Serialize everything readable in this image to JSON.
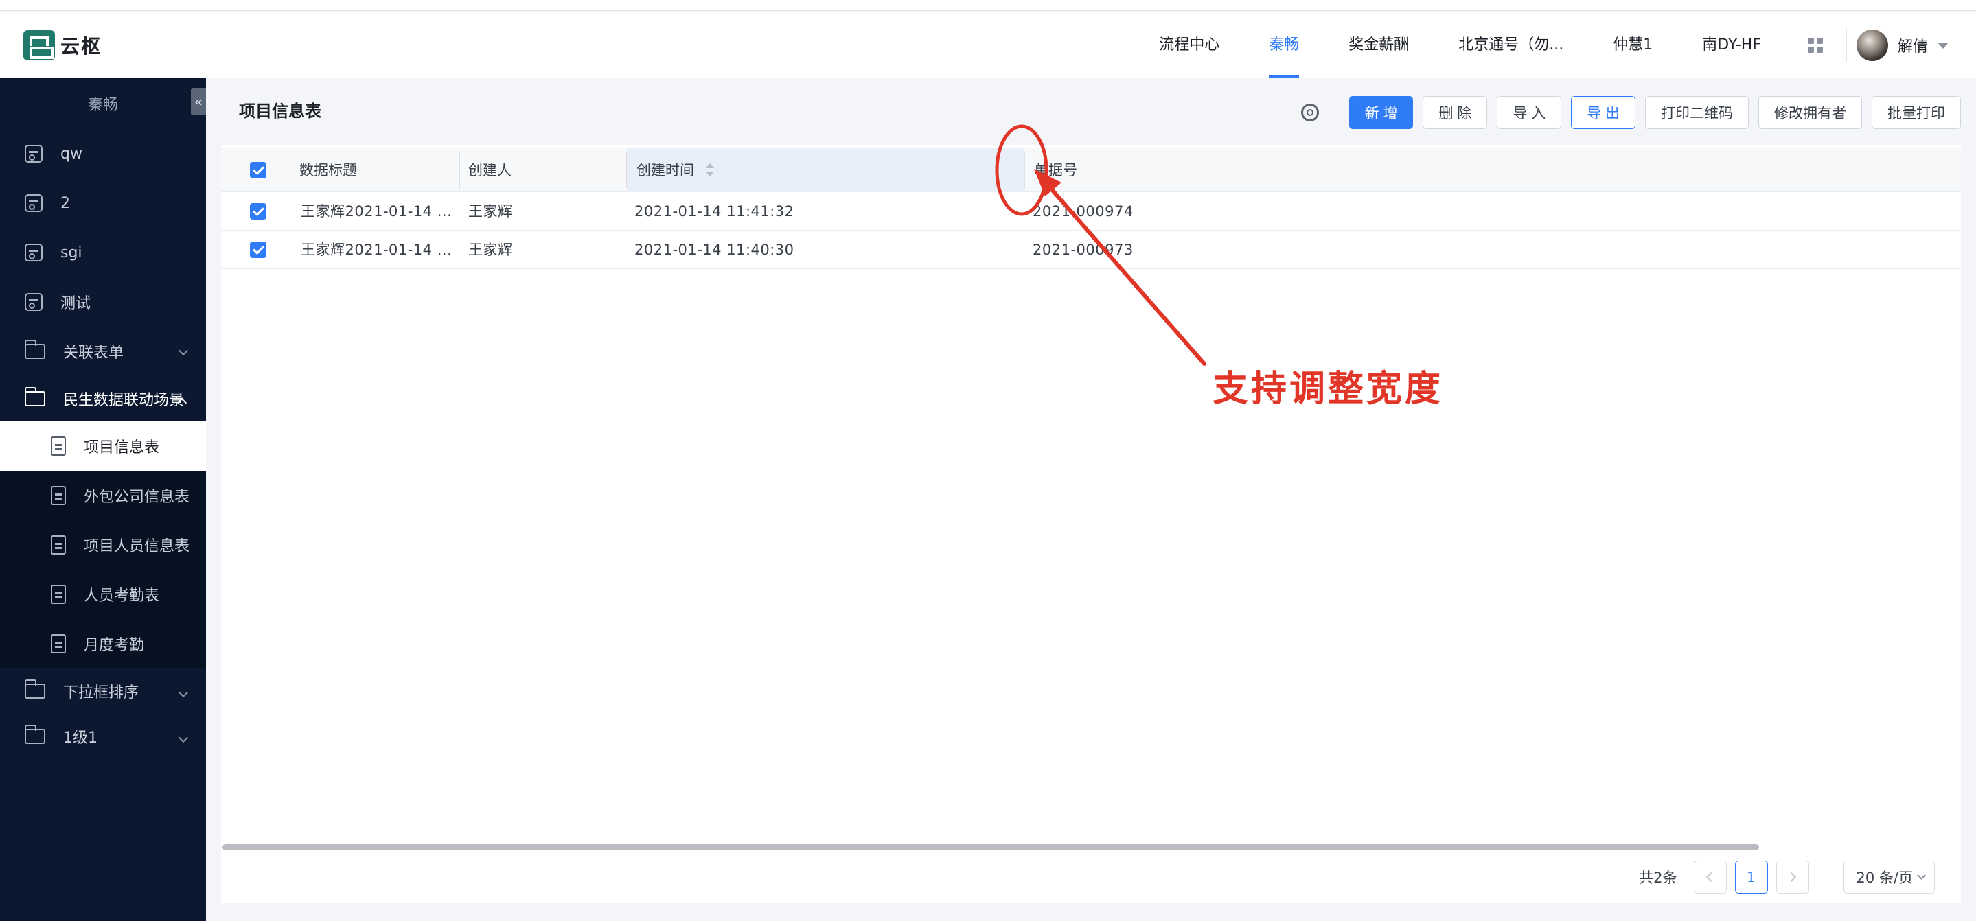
{
  "app": {
    "brand": "云枢"
  },
  "topnav": {
    "items": [
      "流程中心",
      "秦畅",
      "奖金薪酬",
      "北京通号（勿...",
      "仲慧1",
      "南DY-HF"
    ],
    "active_index": 1,
    "user_name": "解倩"
  },
  "sidebar": {
    "title": "秦畅",
    "collapse_glyph": "«",
    "items": [
      {
        "label": "qw",
        "icon": "form-icon"
      },
      {
        "label": "2",
        "icon": "form-icon"
      },
      {
        "label": "sgi",
        "icon": "form-icon"
      },
      {
        "label": "测试",
        "icon": "form-icon"
      },
      {
        "label": "关联表单",
        "icon": "folder-icon"
      },
      {
        "label": "民生数据联动场景",
        "icon": "folder-icon"
      },
      {
        "label": "项目信息表",
        "icon": "document-icon"
      },
      {
        "label": "外包公司信息表",
        "icon": "document-icon"
      },
      {
        "label": "项目人员信息表",
        "icon": "document-icon"
      },
      {
        "label": "人员考勤表",
        "icon": "document-icon"
      },
      {
        "label": "月度考勤",
        "icon": "document-icon"
      },
      {
        "label": "下拉框排序",
        "icon": "folder-icon"
      },
      {
        "label": "1级1",
        "icon": "folder-icon"
      }
    ],
    "active_label": "项目信息表"
  },
  "main": {
    "title": "项目信息表",
    "toolbar": {
      "add": "新 增",
      "delete": "删 除",
      "import": "导 入",
      "export": "导 出",
      "print_qr": "打印二维码",
      "change_owner": "修改拥有者",
      "batch_print": "批量打印"
    },
    "table": {
      "columns": [
        "数据标题",
        "创建人",
        "创建时间",
        "单据号"
      ],
      "sorted_column": "创建时间",
      "rows": [
        {
          "title": "王家辉2021-01-14 ...",
          "creator": "王家辉",
          "created": "2021-01-14 11:41:32",
          "doc_no": "2021-000974",
          "checked": true
        },
        {
          "title": "王家辉2021-01-14 ...",
          "creator": "王家辉",
          "created": "2021-01-14 11:40:30",
          "doc_no": "2021-000973",
          "checked": true
        }
      ]
    },
    "pagination": {
      "total": "共2条",
      "current_page": "1",
      "page_size": "20 条/页"
    }
  },
  "annotation": {
    "text": "支持调整宽度",
    "color": "#e03527"
  },
  "colors": {
    "accent": "#2f7cf6",
    "sidebar_bg": "#0b1830",
    "annotation": "#e03527"
  }
}
